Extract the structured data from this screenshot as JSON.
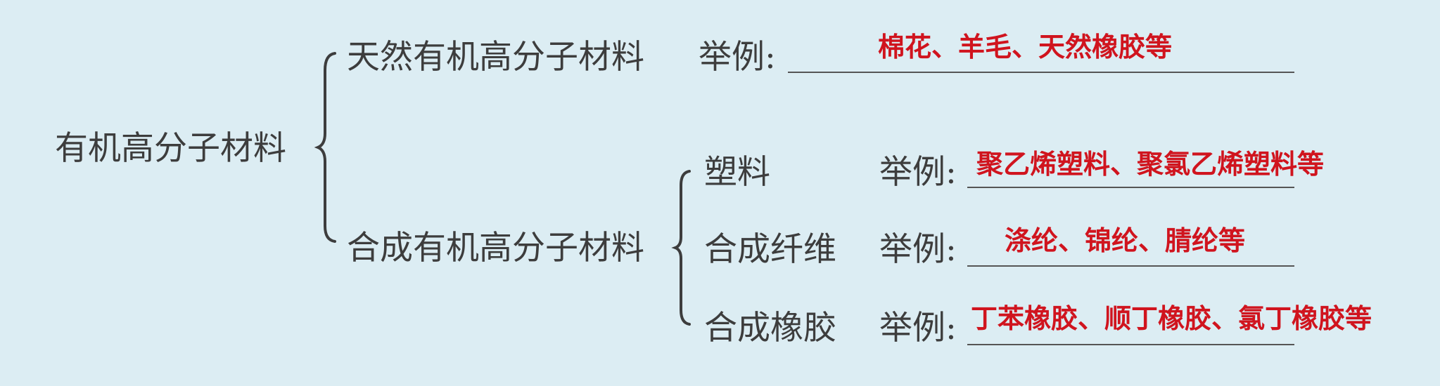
{
  "root": {
    "label": "有机高分子材料"
  },
  "natural": {
    "label": "天然有机高分子材料",
    "example_prefix": "举例:",
    "answer": "棉花、羊毛、天然橡胶等"
  },
  "synthetic": {
    "label": "合成有机高分子材料",
    "children": [
      {
        "label": "塑料",
        "example_prefix": "举例:",
        "answer": "聚乙烯塑料、聚氯乙烯塑料等"
      },
      {
        "label": "合成纤维",
        "example_prefix": "举例:",
        "answer": "涤纶、锦纶、腈纶等"
      },
      {
        "label": "合成橡胶",
        "example_prefix": "举例:",
        "answer": "丁苯橡胶、顺丁橡胶、氯丁橡胶等"
      }
    ]
  },
  "colors": {
    "background": "#dcedf3",
    "text": "#3d3d3d",
    "answer": "#d0141e"
  }
}
